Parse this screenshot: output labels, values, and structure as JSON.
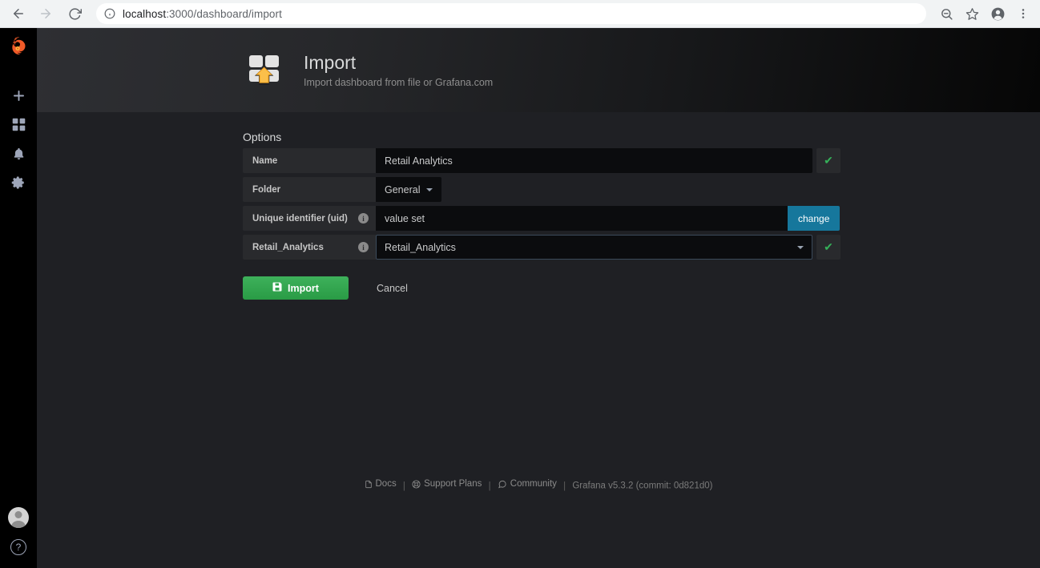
{
  "browser": {
    "back_icon": "back-arrow-icon",
    "forward_icon": "forward-arrow-icon",
    "reload_icon": "reload-icon",
    "site_info_icon": "info-circle-icon",
    "url_host": "localhost",
    "url_path": ":3000/dashboard/import",
    "zoom_icon": "zoom-out-icon",
    "bookmark_icon": "star-icon",
    "profile_icon": "account-icon",
    "menu_icon": "three-dot-menu-icon"
  },
  "sidebar": {
    "logo_icon": "grafana-logo-icon",
    "items": [
      {
        "icon": "plus-icon",
        "name": "create"
      },
      {
        "icon": "dashboards-icon",
        "name": "dashboards"
      },
      {
        "icon": "bell-icon",
        "name": "alerting"
      },
      {
        "icon": "gear-icon",
        "name": "configuration"
      }
    ],
    "avatar_icon": "user-avatar-icon",
    "help_label": "?"
  },
  "header": {
    "icon": "import-dashboard-icon",
    "title": "Import",
    "subtitle": "Import dashboard from file or Grafana.com"
  },
  "form": {
    "section_title": "Options",
    "rows": [
      {
        "label": "Name",
        "has_info": false,
        "value": "Retail Analytics",
        "status": "valid",
        "check_glyph": "✔"
      },
      {
        "label": "Folder",
        "has_info": false,
        "value": "General",
        "type": "select"
      },
      {
        "label": "Unique identifier (uid)",
        "has_info": true,
        "value": "value set",
        "action_label": "change"
      },
      {
        "label": "Retail_Analytics",
        "has_info": true,
        "value": "Retail_Analytics",
        "type": "datasource-select",
        "status": "valid",
        "check_glyph": "✔"
      }
    ],
    "import_label": "Import",
    "import_icon": "save-disk-icon",
    "cancel_label": "Cancel"
  },
  "footer": {
    "docs_icon": "doc-icon",
    "docs_label": "Docs",
    "support_icon": "support-icon",
    "support_label": "Support Plans",
    "community_icon": "community-icon",
    "community_label": "Community",
    "version": "Grafana v5.3.2 (commit: 0d821d0)",
    "separator": "|"
  },
  "colors": {
    "accent_green": "#35b159",
    "accent_teal": "#16779c",
    "orange": "#f2a03d",
    "page_bg": "#1f2024",
    "panel_bg": "#292a2d",
    "input_bg": "#0b0c0e"
  }
}
